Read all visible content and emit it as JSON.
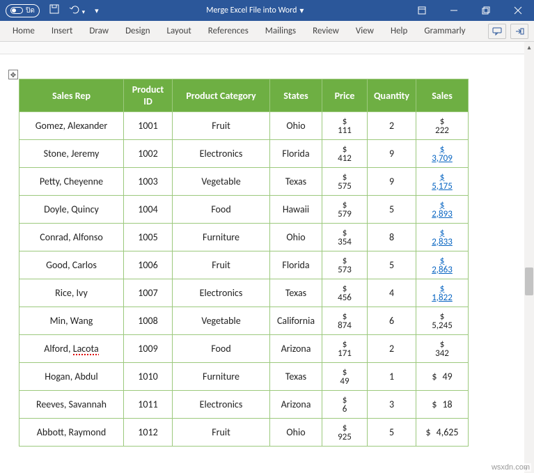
{
  "titlebar": {
    "autosave_label": "ปิด",
    "document_title": "Merge Excel File into Word",
    "dropdown_glyph": "▾"
  },
  "ribbon": {
    "tabs": [
      "Home",
      "Insert",
      "Draw",
      "Design",
      "Layout",
      "References",
      "Mailings",
      "Review",
      "View",
      "Help",
      "Grammarly"
    ]
  },
  "table": {
    "headers": {
      "rep": "Sales Rep",
      "pid": "Product ID",
      "cat": "Product Category",
      "state": "States",
      "price": "Price",
      "qty": "Quantity",
      "sales": "Sales"
    },
    "rows": [
      {
        "rep": "Gomez, Alexander",
        "pid": "1001",
        "cat": "Fruit",
        "state": "Ohio",
        "price": "111",
        "qty": "2",
        "sales": "222",
        "link": false
      },
      {
        "rep": "Stone, Jeremy",
        "pid": "1002",
        "cat": "Electronics",
        "state": "Florida",
        "price": "412",
        "qty": "9",
        "sales": "3,709",
        "link": true
      },
      {
        "rep": "Petty, Cheyenne",
        "pid": "1003",
        "cat": "Vegetable",
        "state": "Texas",
        "price": "575",
        "qty": "9",
        "sales": "5,175",
        "link": true
      },
      {
        "rep": "Doyle, Quincy",
        "pid": "1004",
        "cat": "Food",
        "state": "Hawaii",
        "price": "579",
        "qty": "5",
        "sales": "2,893",
        "link": true
      },
      {
        "rep": "Conrad, Alfonso",
        "pid": "1005",
        "cat": "Furniture",
        "state": "Ohio",
        "price": "354",
        "qty": "8",
        "sales": "2,833",
        "link": true
      },
      {
        "rep": "Good, Carlos",
        "pid": "1006",
        "cat": "Fruit",
        "state": "Florida",
        "price": "573",
        "qty": "5",
        "sales": "2,863",
        "link": true
      },
      {
        "rep": "Rice, Ivy",
        "pid": "1007",
        "cat": "Electronics",
        "state": "Texas",
        "price": "456",
        "qty": "4",
        "sales": "1,822",
        "link": true
      },
      {
        "rep": "Min, Wang",
        "pid": "1008",
        "cat": "Vegetable",
        "state": "California",
        "price": "874",
        "qty": "6",
        "sales": "5,245",
        "link": false
      },
      {
        "rep": "Alford, Lacota",
        "pid": "1009",
        "cat": "Food",
        "state": "Arizona",
        "price": "171",
        "qty": "2",
        "sales": "342",
        "link": false,
        "squiggle": true
      },
      {
        "rep": "Hogan, Abdul",
        "pid": "1010",
        "cat": "Furniture",
        "state": "Texas",
        "price": "49",
        "qty": "1",
        "sales": "49",
        "link": false,
        "flat": true
      },
      {
        "rep": "Reeves, Savannah",
        "pid": "1011",
        "cat": "Electronics",
        "state": "Arizona",
        "price": "6",
        "qty": "3",
        "sales": "18",
        "link": false,
        "flat": true
      },
      {
        "rep": "Abbott, Raymond",
        "pid": "1012",
        "cat": "Fruit",
        "state": "Ohio",
        "price": "925",
        "qty": "5",
        "sales": "4,625",
        "link": false,
        "flat": true
      }
    ]
  },
  "watermark": "wsxdn.com"
}
